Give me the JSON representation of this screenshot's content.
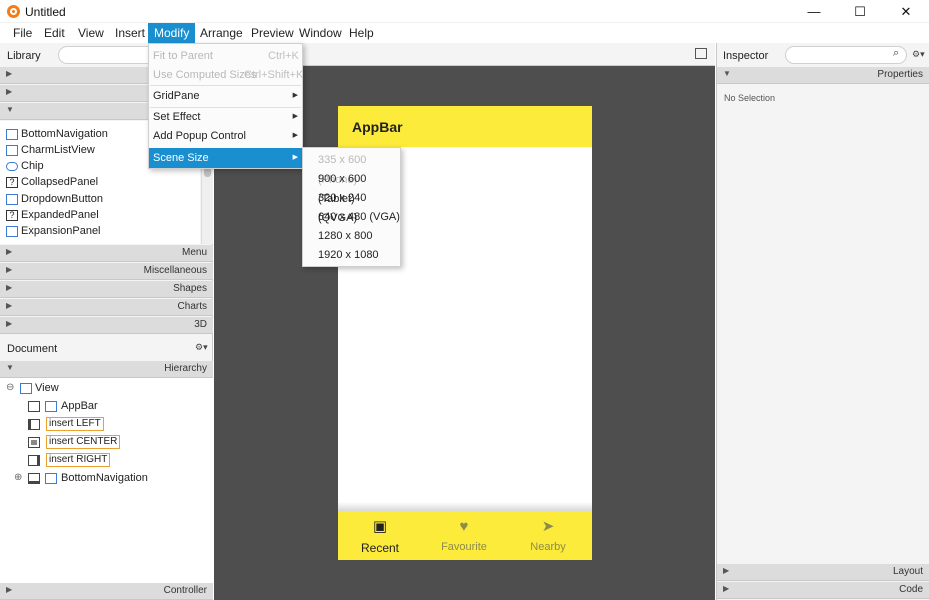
{
  "window": {
    "title": "Untitled",
    "min": "—",
    "max": "☐",
    "close": "✕"
  },
  "menubar": [
    "File",
    "Edit",
    "View",
    "Insert",
    "Modify",
    "Arrange",
    "Preview",
    "Window",
    "Help"
  ],
  "library": {
    "title": "Library",
    "items": [
      "BottomNavigation",
      "CharmListView",
      "Chip",
      "CollapsedPanel",
      "DropdownButton",
      "ExpandedPanel",
      "ExpansionPanel"
    ],
    "sections": [
      "Menu",
      "Miscellaneous",
      "Shapes",
      "Charts",
      "3D"
    ]
  },
  "document": {
    "title": "Document",
    "gear": "⚙▾",
    "hierarchy_label": "Hierarchy",
    "controller_label": "Controller",
    "tree": {
      "root": "View",
      "appbar": "AppBar",
      "left": "insert LEFT",
      "center": "insert CENTER",
      "right": "insert RIGHT",
      "bottom": "BottomNavigation"
    }
  },
  "inspector": {
    "title": "Inspector",
    "properties": "Properties",
    "no_selection": "No Selection",
    "layout": "Layout",
    "code": "Code"
  },
  "preview": {
    "appbar_title": "AppBar",
    "nav": [
      {
        "label": "Recent",
        "icon": "recent-icon"
      },
      {
        "label": "Favourite",
        "icon": "heart-icon"
      },
      {
        "label": "Nearby",
        "icon": "navigation-arrow-icon"
      }
    ],
    "colors": {
      "appbar": "#fceb3b",
      "canvas": "#4e4e4e",
      "menu_highlight": "#1a8fd0"
    }
  },
  "modify_menu": {
    "fit_to_parent": "Fit to Parent",
    "fit_shortcut": "Ctrl+K",
    "use_computed": "Use Computed Sizes",
    "use_computed_shortcut": "Ctrl+Shift+K",
    "gridpane": "GridPane",
    "set_effect": "Set Effect",
    "add_popup": "Add Popup Control",
    "scene_size": "Scene Size"
  },
  "scene_size_menu": [
    "335 x 600 (Phone)",
    "900 x 600 (Tablet)",
    "320 x 240 (QVGA)",
    "640 x 480 (VGA)",
    "1280 x 800",
    "1920 x 1080"
  ]
}
